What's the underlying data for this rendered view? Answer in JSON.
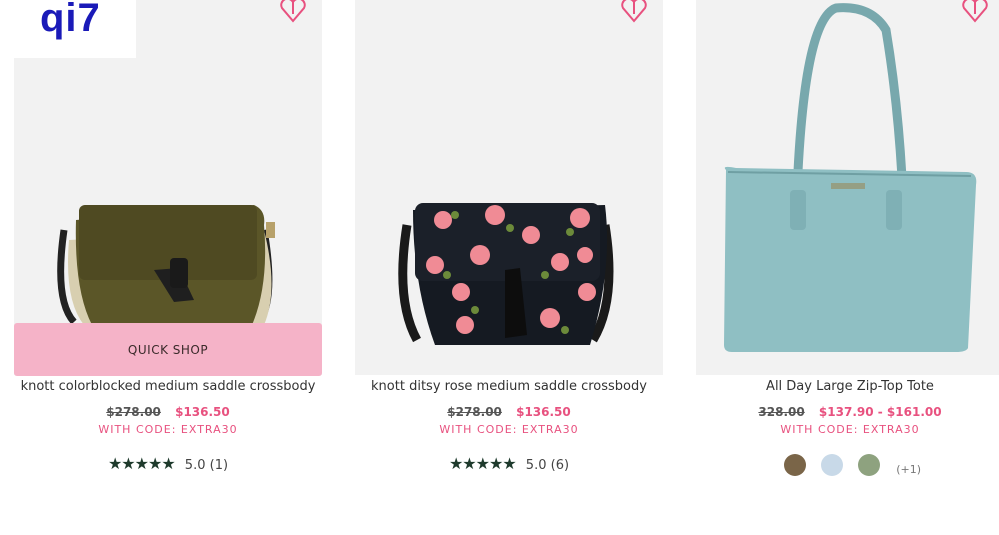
{
  "logo": {
    "text": "qi7"
  },
  "products": [
    {
      "title": "knott colorblocked medium saddle crossbody",
      "original_price": "$278.00",
      "sale_price": "$136.50",
      "promo": "WITH CODE: EXTRA30",
      "rating": "5.0",
      "reviews": "(1)",
      "quick_shop": "QUICK SHOP"
    },
    {
      "title": "knott ditsy rose medium saddle crossbody",
      "original_price": "$278.00",
      "sale_price": "$136.50",
      "promo": "WITH CODE: EXTRA30",
      "rating": "5.0",
      "reviews": "(6)"
    },
    {
      "title": "All Day Large Zip-Top Tote",
      "original_price": "328.00",
      "sale_price": "$137.90 - $161.00",
      "promo": "WITH CODE: EXTRA30",
      "swatches": [
        "#7a6548",
        "#c8d9e8",
        "#8ea27f"
      ],
      "more_colors": "(+1)"
    }
  ],
  "colors": {
    "sale": "#e8517f",
    "quick_shop_bg": "#f5b3c8",
    "stars": "#1e3a2c",
    "heart": "#e8517f"
  }
}
